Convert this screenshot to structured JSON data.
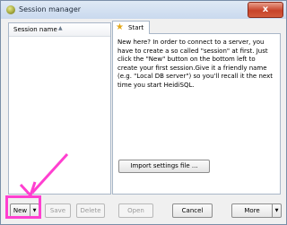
{
  "window": {
    "title": "Session manager",
    "close_glyph": "x"
  },
  "session_list": {
    "column_header": "Session name",
    "sort_glyph": "▲"
  },
  "tabs": [
    {
      "label": "Start",
      "icon": "star-icon"
    }
  ],
  "start_tab": {
    "intro_text": "New here? In order to connect to a server, you have to create a so called \"session\" at first. Just click the \"New\" button on the bottom left to create your first session.Give it a friendly name (e.g. \"Local DB server\") so you'll recall it the next time you start HeidiSQL.",
    "import_button_label": "Import settings file ..."
  },
  "footer": {
    "new_label": "New",
    "new_dropdown_glyph": "▼",
    "save_label": "Save",
    "delete_label": "Delete",
    "open_label": "Open",
    "cancel_label": "Cancel",
    "more_label": "More",
    "more_dropdown_glyph": "▼"
  },
  "colors": {
    "annotation": "#ff3fd0"
  }
}
